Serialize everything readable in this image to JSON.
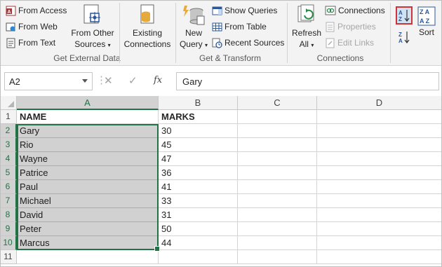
{
  "ribbon": {
    "get_external_data": {
      "label": "Get External Data",
      "from_access": "From Access",
      "from_web": "From Web",
      "from_text": "From Text",
      "from_other_sources_line1": "From Other",
      "from_other_sources_line2": "Sources",
      "existing_connections_line1": "Existing",
      "existing_connections_line2": "Connections"
    },
    "get_transform": {
      "label": "Get & Transform",
      "new_query_line1": "New",
      "new_query_line2": "Query",
      "show_queries": "Show Queries",
      "from_table": "From Table",
      "recent_sources": "Recent Sources"
    },
    "connections": {
      "label": "Connections",
      "refresh_all_line1": "Refresh",
      "refresh_all_line2": "All",
      "connections": "Connections",
      "properties": "Properties",
      "edit_links": "Edit Links"
    },
    "sort": {
      "sort_label": "Sort"
    },
    "colors": {
      "accent": "#217346",
      "highlight_red": "#d13438",
      "icon_blue": "#2b579a",
      "icon_gold": "#e8a93b"
    }
  },
  "formula_bar": {
    "name_box": "A2",
    "cancel_glyph": "✕",
    "enter_glyph": "✓",
    "fx": "fx",
    "value": "Gary"
  },
  "sheet": {
    "columns": [
      "A",
      "B",
      "C",
      "D"
    ],
    "rows": [
      "1",
      "2",
      "3",
      "4",
      "5",
      "6",
      "7",
      "8",
      "9",
      "10",
      "11"
    ],
    "cells": [
      [
        "NAME",
        "MARKS"
      ],
      [
        "Gary",
        "30"
      ],
      [
        "Rio",
        "45"
      ],
      [
        "Wayne",
        "47"
      ],
      [
        "Patrice",
        "36"
      ],
      [
        "Paul",
        "41"
      ],
      [
        "Michael",
        "33"
      ],
      [
        "David",
        "31"
      ],
      [
        "Peter",
        "50"
      ],
      [
        "Marcus",
        "44"
      ],
      [
        "",
        ""
      ]
    ],
    "selection": "A2:A10",
    "active_cell": "A2"
  }
}
